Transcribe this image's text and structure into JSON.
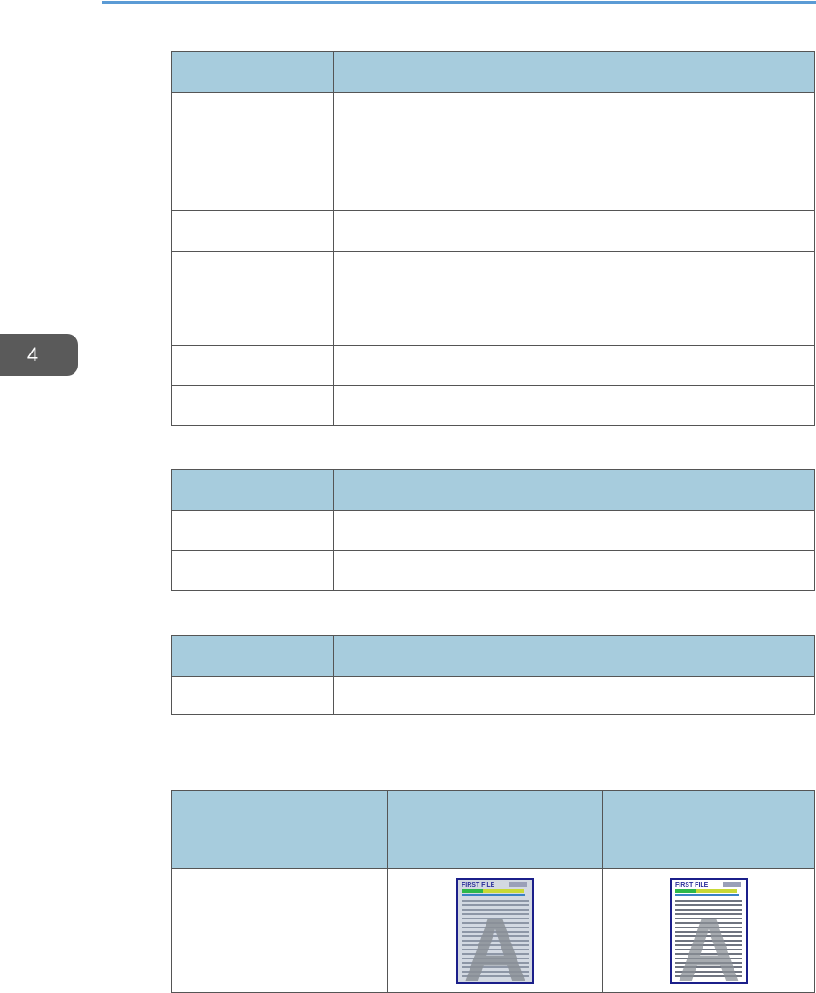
{
  "chapter": {
    "number": "4"
  },
  "tables": [
    {
      "rows": 6
    },
    {
      "rows": 3
    },
    {
      "rows": 2
    },
    {
      "rows": 2,
      "columns": 3
    }
  ],
  "samples": {
    "left_header_text": "FIRST FILE",
    "right_header_text": "FIRST FILE",
    "big_letter": "A"
  },
  "colors": {
    "header_fill": "#a7ccdd",
    "rule": "#5b9bd5",
    "tab": "#5a5a5a",
    "thumb_border": "#1b1f8a"
  }
}
